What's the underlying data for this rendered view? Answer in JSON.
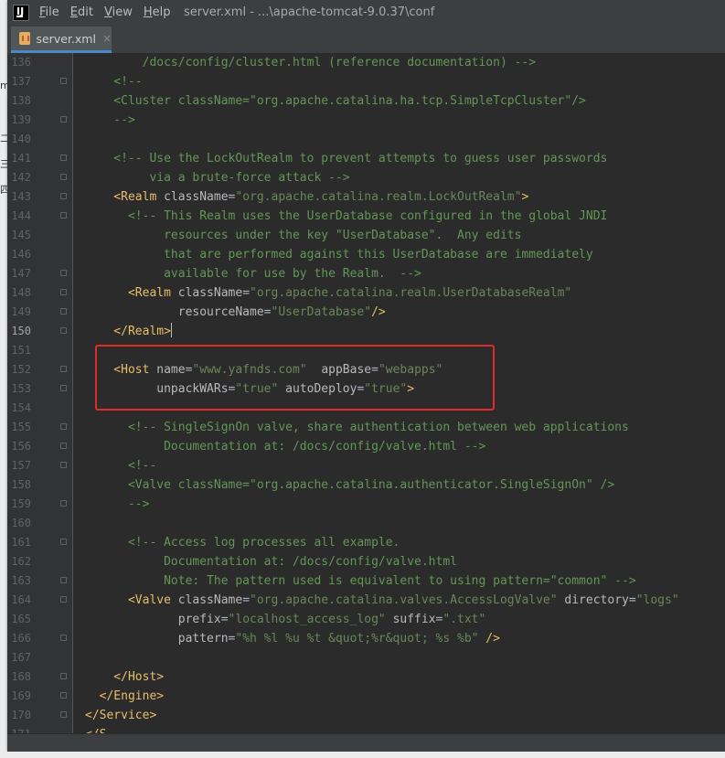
{
  "app": {
    "logo_icon": "intellij-idea-icon",
    "menu": [
      {
        "key": "F",
        "rest": "ile"
      },
      {
        "key": "E",
        "rest": "dit"
      },
      {
        "key": "V",
        "rest": "iew"
      },
      {
        "key": "H",
        "rest": "elp"
      }
    ],
    "window_title": "server.xml - ...\\apache-tomcat-9.0.37\\conf"
  },
  "tabs": [
    {
      "label": "server.xml",
      "icon": "xml-file-icon",
      "close": "×"
    }
  ],
  "background_glyphs": [
    "m",
    "二",
    "三",
    "四"
  ],
  "editor": {
    "current_line": 150,
    "colors": {
      "comment": "#629755",
      "tag": "#e8bf6a",
      "attribute": "#bababa",
      "value": "#6a8759",
      "text": "#a9b7c6",
      "highlight_box": "#e02b2b"
    },
    "lines": [
      {
        "n": 136,
        "parts": [
          [
            "c",
            "        /docs/config/cluster.html (reference documentation) -->"
          ]
        ]
      },
      {
        "n": 137,
        "parts": [
          [
            "c",
            "    <!--"
          ]
        ]
      },
      {
        "n": 138,
        "parts": [
          [
            "c",
            "    <Cluster className=\"org.apache.catalina.ha.tcp.SimpleTcpCluster\"/>"
          ]
        ]
      },
      {
        "n": 139,
        "parts": [
          [
            "c",
            "    -->"
          ]
        ]
      },
      {
        "n": 140,
        "parts": []
      },
      {
        "n": 141,
        "parts": [
          [
            "c",
            "    <!-- Use the LockOutRealm to prevent attempts to guess user passwords"
          ]
        ]
      },
      {
        "n": 142,
        "parts": [
          [
            "c",
            "         via a brute-force attack -->"
          ]
        ]
      },
      {
        "n": 143,
        "parts": [
          [
            "t",
            "    <Realm "
          ],
          [
            "a",
            "className"
          ],
          [
            "p",
            "="
          ],
          [
            "v",
            "\"org.apache.catalina.realm.LockOutRealm\""
          ],
          [
            "t",
            ">"
          ]
        ]
      },
      {
        "n": 144,
        "parts": [
          [
            "c",
            "      <!-- This Realm uses the UserDatabase configured in the global JNDI"
          ]
        ]
      },
      {
        "n": 145,
        "parts": [
          [
            "c",
            "           resources under the key \"UserDatabase\".  Any edits"
          ]
        ]
      },
      {
        "n": 146,
        "parts": [
          [
            "c",
            "           that are performed against this UserDatabase are immediately"
          ]
        ]
      },
      {
        "n": 147,
        "parts": [
          [
            "c",
            "           available for use by the Realm.  -->"
          ]
        ]
      },
      {
        "n": 148,
        "parts": [
          [
            "t",
            "      <Realm "
          ],
          [
            "a",
            "className"
          ],
          [
            "p",
            "="
          ],
          [
            "v",
            "\"org.apache.catalina.realm.UserDatabaseRealm\""
          ]
        ]
      },
      {
        "n": 149,
        "parts": [
          [
            "a",
            "             resourceName"
          ],
          [
            "p",
            "="
          ],
          [
            "v",
            "\"UserDatabase\""
          ],
          [
            "t",
            "/>"
          ]
        ]
      },
      {
        "n": 150,
        "parts": [
          [
            "t",
            "    </Realm>"
          ]
        ],
        "caret": true
      },
      {
        "n": 151,
        "parts": []
      },
      {
        "n": 152,
        "parts": [
          [
            "t",
            "    <Host "
          ],
          [
            "a",
            "name"
          ],
          [
            "p",
            "="
          ],
          [
            "v",
            "\"www.yafnds.com\""
          ],
          [
            "p",
            "  "
          ],
          [
            "a",
            "appBase"
          ],
          [
            "p",
            "="
          ],
          [
            "v",
            "\"webapps\""
          ]
        ]
      },
      {
        "n": 153,
        "parts": [
          [
            "a",
            "          unpackWARs"
          ],
          [
            "p",
            "="
          ],
          [
            "v",
            "\"true\""
          ],
          [
            "p",
            " "
          ],
          [
            "a",
            "autoDeploy"
          ],
          [
            "p",
            "="
          ],
          [
            "v",
            "\"true\""
          ],
          [
            "t",
            ">"
          ]
        ]
      },
      {
        "n": 154,
        "parts": []
      },
      {
        "n": 155,
        "parts": [
          [
            "c",
            "      <!-- SingleSignOn valve, share authentication between web applications"
          ]
        ]
      },
      {
        "n": 156,
        "parts": [
          [
            "c",
            "           Documentation at: /docs/config/valve.html -->"
          ]
        ]
      },
      {
        "n": 157,
        "parts": [
          [
            "c",
            "      <!--"
          ]
        ]
      },
      {
        "n": 158,
        "parts": [
          [
            "c",
            "      <Valve className=\"org.apache.catalina.authenticator.SingleSignOn\" />"
          ]
        ]
      },
      {
        "n": 159,
        "parts": [
          [
            "c",
            "      -->"
          ]
        ]
      },
      {
        "n": 160,
        "parts": []
      },
      {
        "n": 161,
        "parts": [
          [
            "c",
            "      <!-- Access log processes all example."
          ]
        ]
      },
      {
        "n": 162,
        "parts": [
          [
            "c",
            "           Documentation at: /docs/config/valve.html"
          ]
        ]
      },
      {
        "n": 163,
        "parts": [
          [
            "c",
            "           Note: The pattern used is equivalent to using pattern=\"common\" -->"
          ]
        ]
      },
      {
        "n": 164,
        "parts": [
          [
            "t",
            "      <Valve "
          ],
          [
            "a",
            "className"
          ],
          [
            "p",
            "="
          ],
          [
            "v",
            "\"org.apache.catalina.valves.AccessLogValve\""
          ],
          [
            "p",
            " "
          ],
          [
            "a",
            "directory"
          ],
          [
            "p",
            "="
          ],
          [
            "v",
            "\"logs\""
          ]
        ]
      },
      {
        "n": 165,
        "parts": [
          [
            "a",
            "             prefix"
          ],
          [
            "p",
            "="
          ],
          [
            "v",
            "\"localhost_access_log\""
          ],
          [
            "p",
            " "
          ],
          [
            "a",
            "suffix"
          ],
          [
            "p",
            "="
          ],
          [
            "v",
            "\".txt\""
          ]
        ]
      },
      {
        "n": 166,
        "parts": [
          [
            "a",
            "             pattern"
          ],
          [
            "p",
            "="
          ],
          [
            "v",
            "\"%h %l %u %t &quot;%r&quot; %s %b\""
          ],
          [
            "t",
            " />"
          ]
        ]
      },
      {
        "n": 167,
        "parts": []
      },
      {
        "n": 168,
        "parts": [
          [
            "t",
            "    </Host>"
          ]
        ]
      },
      {
        "n": 169,
        "parts": [
          [
            "t",
            "  </Engine>"
          ]
        ]
      },
      {
        "n": 170,
        "parts": [
          [
            "t",
            "</Service>"
          ]
        ]
      },
      {
        "n": 171,
        "parts": [
          [
            "t",
            "</S"
          ]
        ]
      }
    ]
  }
}
